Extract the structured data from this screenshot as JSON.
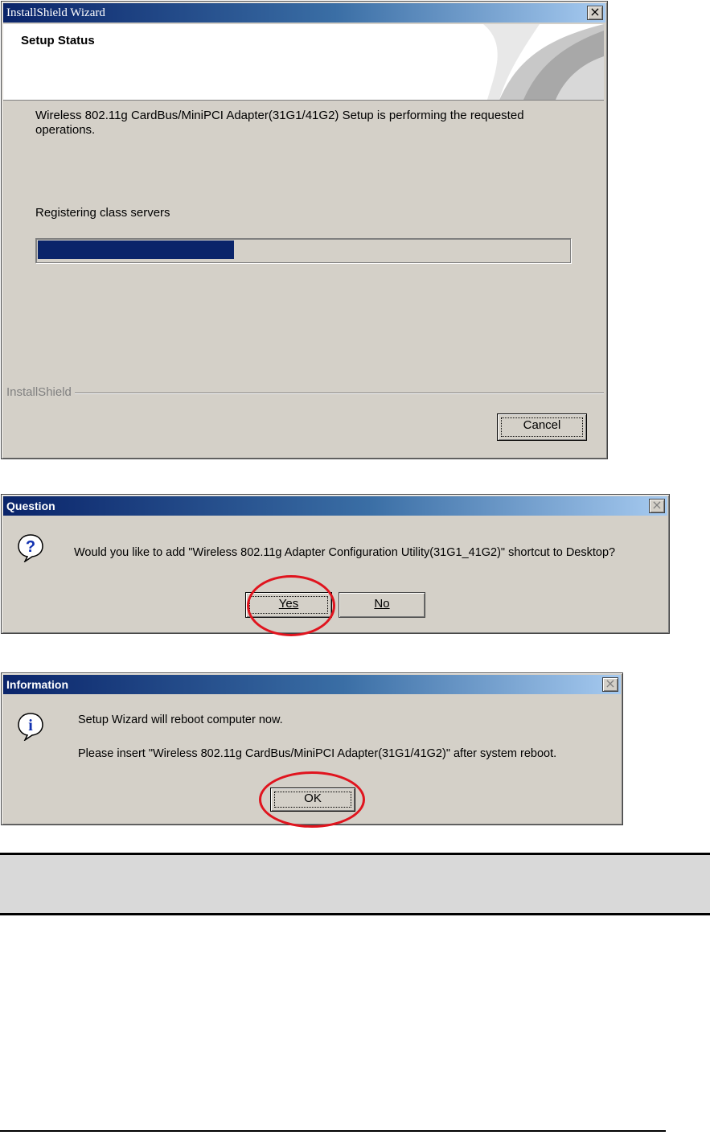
{
  "wizard": {
    "title": "InstallShield Wizard",
    "header_title": "Setup Status",
    "message": "Wireless 802.11g CardBus/MiniPCI Adapter(31G1/41G2) Setup is performing the requested operations.",
    "status": "Registering class servers",
    "progress_fraction": 0.37,
    "brand": "InstallShield",
    "cancel_label": "Cancel",
    "close_glyph": "×"
  },
  "question": {
    "title": "Question",
    "icon": "question-icon",
    "message": "Would you like to add \"Wireless 802.11g Adapter Configuration Utility(31G1_41G2)\" shortcut to Desktop?",
    "yes_label": "Yes",
    "no_label": "No",
    "close_glyph": "×"
  },
  "information": {
    "title": "Information",
    "icon": "info-icon",
    "line1": "Setup Wizard will reboot computer now.",
    "line2": "Please insert \"Wireless 802.11g CardBus/MiniPCI Adapter(31G1/41G2)\" after system reboot.",
    "ok_label": "OK",
    "close_glyph": "×"
  },
  "colors": {
    "highlight": "#e0141e",
    "title_bar": "#0a246a",
    "progress": "#0a246a",
    "dialog_bg": "#d4d0c8"
  }
}
